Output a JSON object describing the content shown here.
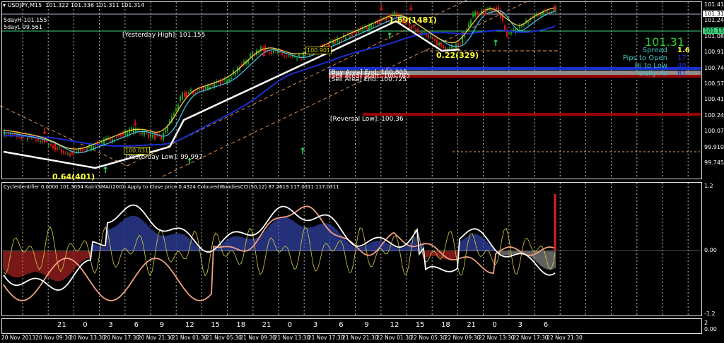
{
  "header": {
    "symbol": "USDJPY,M15",
    "ohlc": "101.322 101.336 101.311 101.314",
    "five_day_high": "5dayH 101.155",
    "five_day_low": "5dayL 99.561"
  },
  "price_axis": {
    "ticks": [
      "101.410",
      "101.245",
      "101.080",
      "100.910",
      "100.745",
      "100.575",
      "100.410",
      "100.245",
      "100.075",
      "99.910",
      "99.745"
    ],
    "current_price": "101.314",
    "yesterday_high_marker": "101.155"
  },
  "info_panel": {
    "price": "101.31",
    "spread_label": "Spread",
    "spread_value": "1.6",
    "pips_to_open_label": "Pips to Open",
    "pips_to_open_value": "17",
    "hi_to_low_label": "Hi to Low",
    "hi_to_low_value": "48",
    "daily_av_label": "Daily Av",
    "daily_av_value": "81"
  },
  "chart_labels": {
    "yesterday_high": "[Yesterday High]: 101.155",
    "yesterday_low": "[Yesterday Low]: 99.997",
    "buy_area_end": "[Buy Area] End: 100.805",
    "sell_area_start": "[Sell Area] Start: 100.785",
    "sell_area_end": "[Sell Area] End: 100.725",
    "reversal_low": "[Reversal Low]: 100.36",
    "swing1": "0.64(401)",
    "swing2": "1.69(1481)",
    "swing3": "0.22(329)",
    "box1": "100.031",
    "box2": "100.901"
  },
  "indicator": {
    "legend": "CycleIdentifier 0.0000 101.3054  Kairi(SMA((200)) Apply to Close price 0.4324  ColouredWoodiesCCI(50,12) 87.2619 117.0311 117.0311",
    "ticks": [
      "1.2",
      "0.00",
      "-1.2"
    ]
  },
  "time_axis": {
    "hours": [
      "21",
      "0",
      "3",
      "6",
      "9",
      "12",
      "15",
      "18",
      "21",
      "0",
      "3",
      "6",
      "9",
      "12",
      "15",
      "18",
      "21",
      "0",
      "3",
      "6"
    ],
    "dates": [
      "20 Nov 2013",
      "20 Nov 09:30",
      "20 Nov 13:30",
      "20 Nov 17:30",
      "20 Nov 21:30",
      "21 Nov 01:30",
      "21 Nov 05:30",
      "21 Nov 09:30",
      "21 Nov 13:30",
      "21 Nov 17:30",
      "21 Nov 21:30",
      "22 Nov 01:30",
      "22 Nov 05:30",
      "22 Nov 09:30",
      "22 Nov 13:30",
      "22 Nov 17:30",
      "22 Nov 21:30"
    ],
    "right_label_top": "2",
    "right_label_bottom": "0.00"
  },
  "colors": {
    "bull": "#1fa51f",
    "bear": "#e01818",
    "ma_blue": "#1a2fd0",
    "cyan": "#40c0e0",
    "yellow": "#f0d040",
    "salmon": "#f0a080"
  }
}
